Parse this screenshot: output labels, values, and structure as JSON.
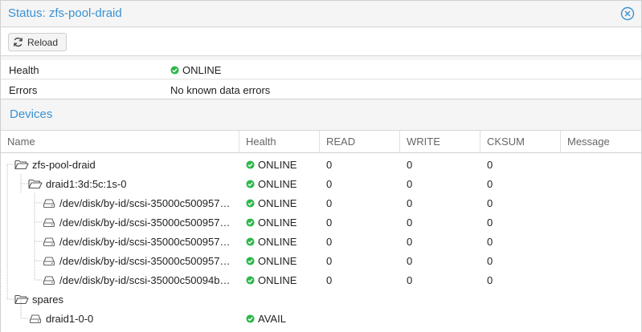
{
  "window": {
    "title": "Status: zfs-pool-draid"
  },
  "toolbar": {
    "reload_label": "Reload"
  },
  "summary": {
    "health_label": "Health",
    "health_value": "ONLINE",
    "errors_label": "Errors",
    "errors_value": "No known data errors"
  },
  "devices": {
    "title": "Devices",
    "columns": [
      "Name",
      "Health",
      "READ",
      "WRITE",
      "CKSUM",
      "Message"
    ],
    "rows": [
      {
        "name": "zfs-pool-draid",
        "health": "ONLINE",
        "read": "0",
        "write": "0",
        "cksum": "0",
        "message": "",
        "icon": "folder-open-icon"
      },
      {
        "name": "draid1:3d:5c:1s-0",
        "health": "ONLINE",
        "read": "0",
        "write": "0",
        "cksum": "0",
        "message": "",
        "icon": "folder-open-icon"
      },
      {
        "name": "/dev/disk/by-id/scsi-35000c500957…",
        "health": "ONLINE",
        "read": "0",
        "write": "0",
        "cksum": "0",
        "message": "",
        "icon": "hdd-icon"
      },
      {
        "name": "/dev/disk/by-id/scsi-35000c500957…",
        "health": "ONLINE",
        "read": "0",
        "write": "0",
        "cksum": "0",
        "message": "",
        "icon": "hdd-icon"
      },
      {
        "name": "/dev/disk/by-id/scsi-35000c500957…",
        "health": "ONLINE",
        "read": "0",
        "write": "0",
        "cksum": "0",
        "message": "",
        "icon": "hdd-icon"
      },
      {
        "name": "/dev/disk/by-id/scsi-35000c500957…",
        "health": "ONLINE",
        "read": "0",
        "write": "0",
        "cksum": "0",
        "message": "",
        "icon": "hdd-icon"
      },
      {
        "name": "/dev/disk/by-id/scsi-35000c50094b…",
        "health": "ONLINE",
        "read": "0",
        "write": "0",
        "cksum": "0",
        "message": "",
        "icon": "hdd-icon"
      },
      {
        "name": "spares",
        "health": "",
        "read": "",
        "write": "",
        "cksum": "",
        "message": "",
        "icon": "folder-open-icon"
      },
      {
        "name": "draid1-0-0",
        "health": "AVAIL",
        "read": "",
        "write": "",
        "cksum": "",
        "message": "",
        "icon": "hdd-icon"
      }
    ]
  },
  "colors": {
    "accent": "#3892d4",
    "ok": "#2db84c"
  }
}
